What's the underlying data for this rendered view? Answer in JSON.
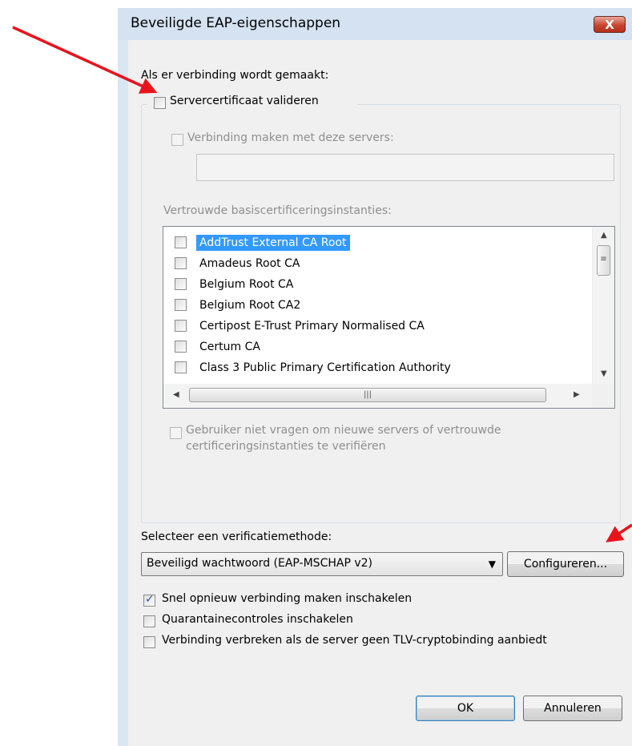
{
  "window": {
    "title": "Beveiligde EAP-eigenschappen",
    "close_label": "X"
  },
  "connection_label": "Als er verbinding wordt gemaakt:",
  "validate_cert": {
    "label": "Servercertificaat valideren",
    "checked": false
  },
  "connect_servers": {
    "label": "Verbinding maken met deze servers:",
    "checked": false,
    "value": ""
  },
  "trusted_ca": {
    "label": "Vertrouwde basiscertificeringsinstanties:",
    "items": [
      {
        "label": "AddTrust External CA Root",
        "checked": false,
        "selected": true
      },
      {
        "label": "Amadeus Root CA",
        "checked": false
      },
      {
        "label": "Belgium Root CA",
        "checked": false
      },
      {
        "label": "Belgium Root CA2",
        "checked": false
      },
      {
        "label": "Certipost E-Trust Primary Normalised CA",
        "checked": false
      },
      {
        "label": "Certum CA",
        "checked": false
      },
      {
        "label": "Class 3 Public Primary Certification Authority",
        "checked": false
      }
    ]
  },
  "no_prompt": {
    "line1": "Gebruiker niet vragen om nieuwe servers of vertrouwde",
    "line2": "certificeringsinstanties te verifiëren",
    "checked": false
  },
  "auth_method": {
    "label": "Selecteer een verificatiemethode:",
    "selected": "Beveiligd wachtwoord (EAP-MSCHAP v2)",
    "configure_label": "Configureren..."
  },
  "options": [
    {
      "label": "Snel opnieuw verbinding maken inschakelen",
      "checked": true
    },
    {
      "label": "Quarantainecontroles inschakelen",
      "checked": false
    },
    {
      "label": "Verbinding verbreken als de server geen TLV-cryptobinding aanbiedt",
      "checked": false
    }
  ],
  "buttons": {
    "ok": "OK",
    "cancel": "Annuleren"
  },
  "colors": {
    "annotation_arrow": "#e8141c",
    "selection": "#3399ff",
    "close_button": "#c8452f"
  }
}
